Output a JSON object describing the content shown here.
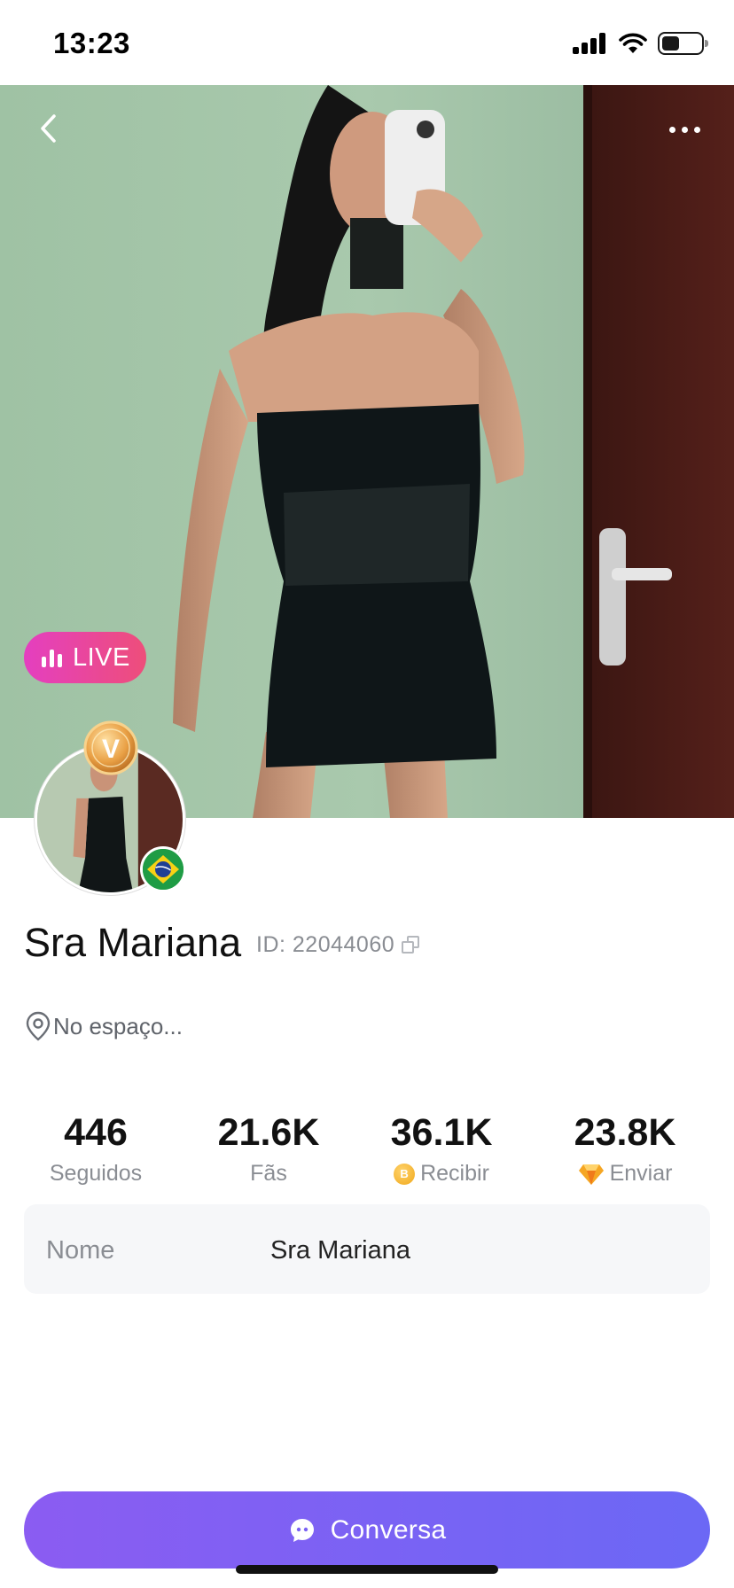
{
  "status_bar": {
    "time": "13:23",
    "battery_level": 0.45
  },
  "header": {
    "back_icon": "chevron-left-icon",
    "more_icon": "more-horizontal-icon"
  },
  "hero": {
    "live_badge": "LIVE",
    "live_badge_colors": [
      "#e43fc0",
      "#ee4e7a"
    ]
  },
  "profile": {
    "name": "Sra Mariana",
    "id": "ID: 22044060",
    "location": "No espaço...",
    "vip_badge_letter": "V",
    "flag_icon": "brazil-flag-icon"
  },
  "stats": [
    {
      "value": "446",
      "label": "Seguidos",
      "icon": ""
    },
    {
      "value": "21.6K",
      "label": "Fãs",
      "icon": ""
    },
    {
      "value": "36.1K",
      "label": "Recibir",
      "icon": "coin-icon"
    },
    {
      "value": "23.8K",
      "label": "Enviar",
      "icon": "diamond-icon"
    }
  ],
  "info": {
    "key": "Nome",
    "value": "Sra Mariana"
  },
  "chat_button": {
    "label": "Conversa",
    "colors": [
      "#8b5cf2",
      "#6b68f5"
    ]
  }
}
